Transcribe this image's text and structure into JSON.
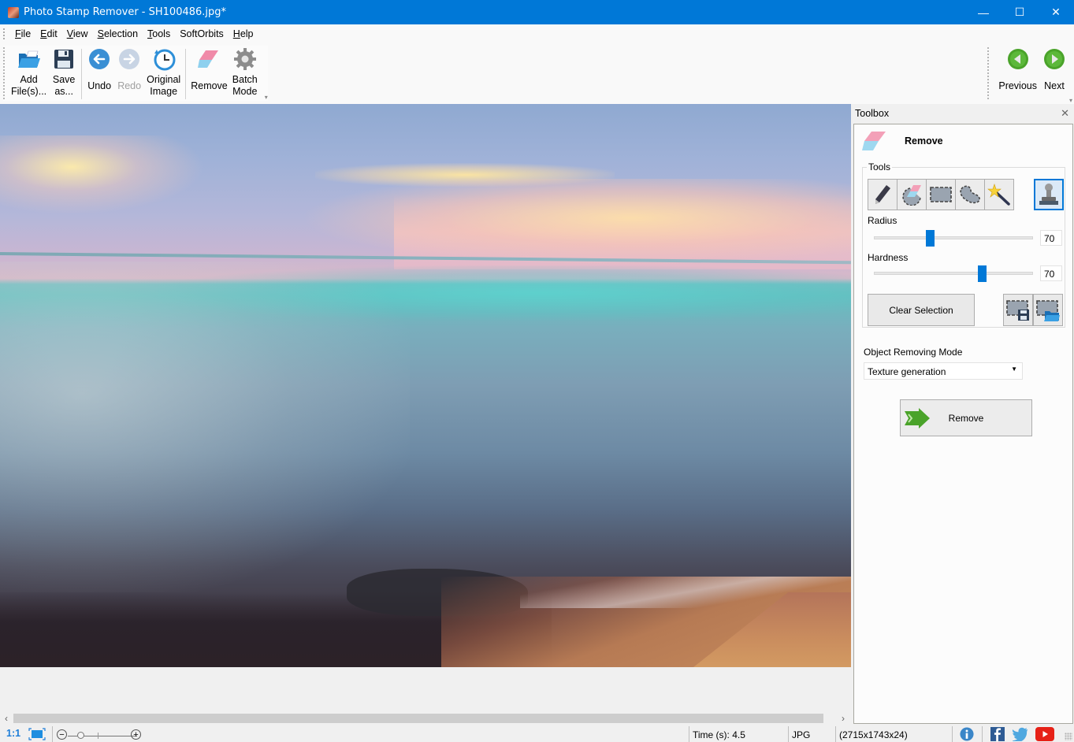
{
  "window": {
    "title": "Photo Stamp Remover - SH100486.jpg*",
    "controls": {
      "minimize": "—",
      "maximize": "☐",
      "close": "✕"
    }
  },
  "menu": [
    {
      "label": "File",
      "mnemonic": "F",
      "rest": "ile"
    },
    {
      "label": "Edit",
      "mnemonic": "E",
      "rest": "dit"
    },
    {
      "label": "View",
      "mnemonic": "V",
      "rest": "iew"
    },
    {
      "label": "Selection",
      "mnemonic": "S",
      "rest": "election"
    },
    {
      "label": "Tools",
      "mnemonic": "T",
      "rest": "ools"
    },
    {
      "label": "SoftOrbits",
      "mnemonic": "",
      "rest": "SoftOrbits"
    },
    {
      "label": "Help",
      "mnemonic": "H",
      "rest": "elp"
    }
  ],
  "toolbar": {
    "add_files": {
      "line1": "Add",
      "line2": "File(s)...",
      "icon": "folder-open-icon"
    },
    "save_as": {
      "line1": "Save",
      "line2": "as...",
      "icon": "floppy-disk-icon"
    },
    "undo": {
      "label": "Undo",
      "icon": "arrow-left-icon",
      "enabled": true
    },
    "redo": {
      "label": "Redo",
      "icon": "arrow-right-icon",
      "enabled": false
    },
    "original_image": {
      "line1": "Original",
      "line2": "Image",
      "icon": "clock-history-icon"
    },
    "remove": {
      "label": "Remove",
      "icon": "eraser-icon"
    },
    "batch_mode": {
      "line1": "Batch",
      "line2": "Mode",
      "icon": "gear-icon"
    },
    "previous": {
      "label": "Previous",
      "icon": "green-left-arrow-icon"
    },
    "next": {
      "label": "Next",
      "icon": "green-right-arrow-icon"
    }
  },
  "canvas": {
    "image_description": "Sunset seascape with pink sky, turquoise sea and rocky shore"
  },
  "toolbox": {
    "title": "Toolbox",
    "section_title": "Remove",
    "tools_group_label": "Tools",
    "tools": [
      {
        "name": "pencil",
        "icon": "pencil-icon"
      },
      {
        "name": "eraser-selection",
        "icon": "selection-eraser-icon"
      },
      {
        "name": "rectangle-selection",
        "icon": "rectangle-selection-icon"
      },
      {
        "name": "lasso",
        "icon": "lasso-icon"
      },
      {
        "name": "magic-wand",
        "icon": "magic-wand-icon"
      }
    ],
    "stamp_tool": {
      "name": "stamp",
      "icon": "stamp-icon",
      "active": true
    },
    "radius": {
      "label": "Radius",
      "value": "70",
      "position": 0.35
    },
    "hardness": {
      "label": "Hardness",
      "value": "70",
      "position": 0.68
    },
    "clear_selection": "Clear Selection",
    "save_selection_icon": "save-selection-icon",
    "load_selection_icon": "load-selection-icon",
    "mode_label": "Object Removing Mode",
    "mode_value": "Texture generation",
    "remove_button": "Remove"
  },
  "statusbar": {
    "one_to_one": "1:1",
    "time": "Time (s): 4.5",
    "format": "JPG",
    "dimensions": "(2715x1743x24)",
    "zoom_level": 0.15
  },
  "colors": {
    "titlebar": "#0078d7",
    "accent": "#0078d7",
    "nav_green": "#4aa32a"
  }
}
